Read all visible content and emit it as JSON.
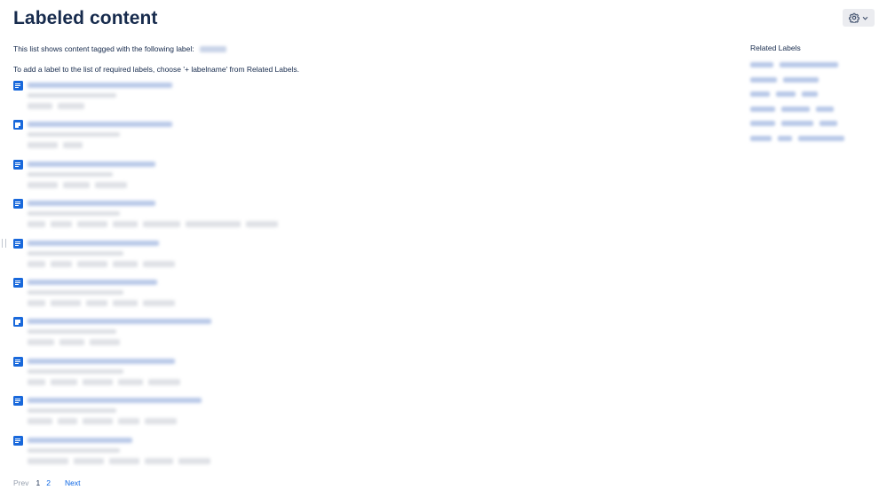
{
  "header": {
    "title": "Labeled content",
    "settings_icon": "gear-icon",
    "settings_caret_icon": "chevron-down-icon"
  },
  "intro": {
    "line1": "This list shows content tagged with the following label:",
    "line2": "To add a label to the list of required labels, choose '+ labelname' from Related Labels."
  },
  "sidebar": {
    "heading": "Related Labels"
  },
  "results": {
    "item_icon": "page-icon",
    "count": 10
  },
  "pagination": {
    "prev": "Prev",
    "pages": [
      "1",
      "2"
    ],
    "current": "1",
    "next": "Next"
  },
  "colors": {
    "link": "#0c66e4",
    "text": "#172b4d",
    "icon": "#1868db",
    "button_bg": "#ebecf0"
  }
}
